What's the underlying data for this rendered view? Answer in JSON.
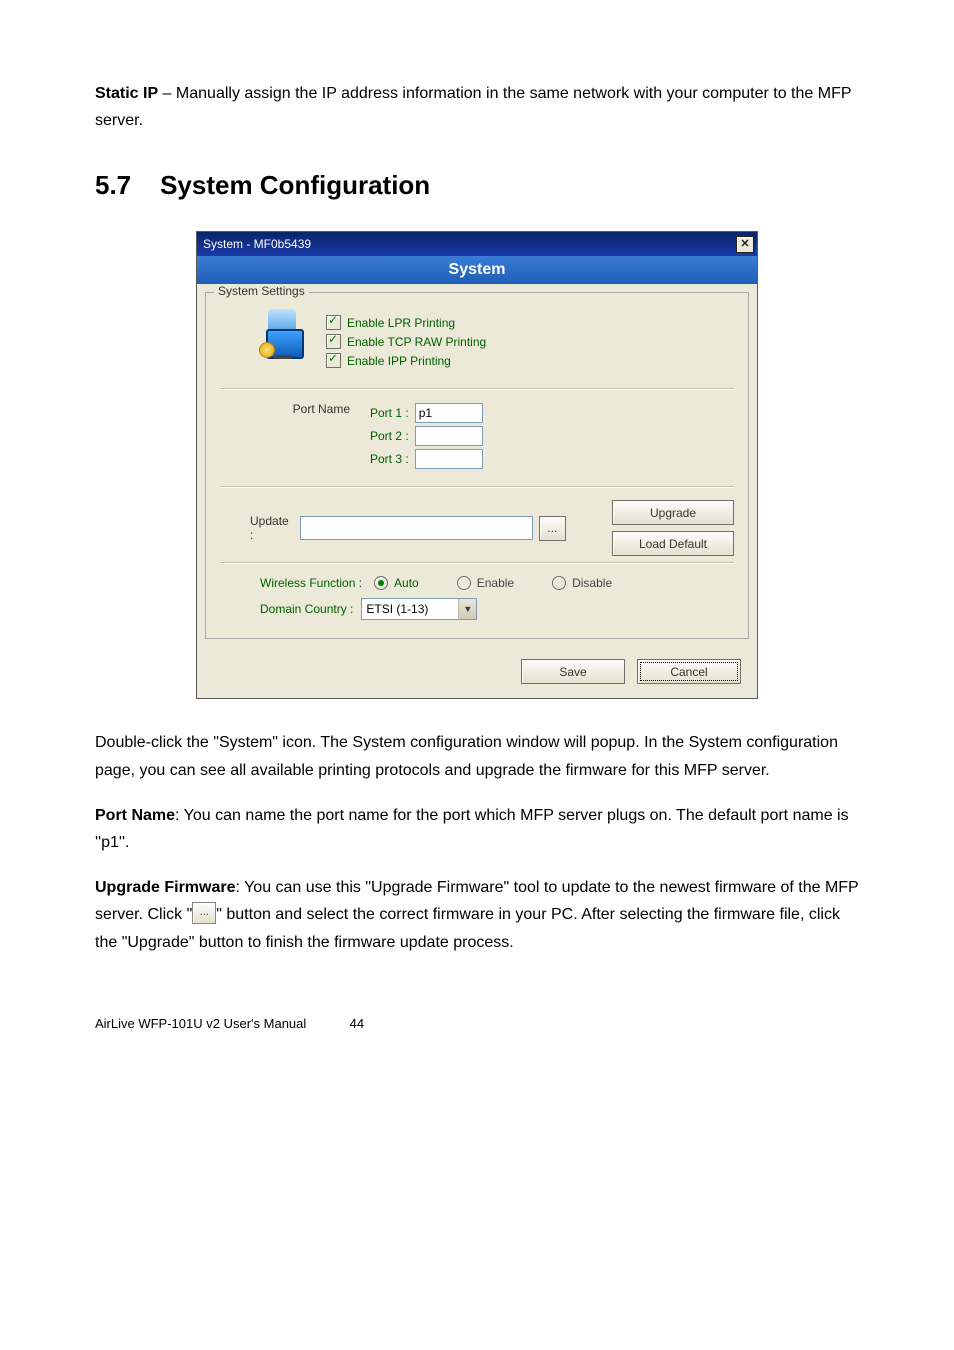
{
  "intro": {
    "static_ip_label": "Static IP",
    "static_ip_text": " – Manually assign the IP address information in the same network with your computer to the MFP server."
  },
  "heading": {
    "number": "5.7",
    "title": "System Configuration"
  },
  "dialog": {
    "titlebar": "System - MF0b5439",
    "close_x": "✕",
    "banner": "System",
    "group_legend": "System Settings",
    "checks": {
      "lpr": "Enable LPR Printing",
      "tcp": "Enable TCP RAW Printing",
      "ipp": "Enable IPP Printing"
    },
    "port_name_label": "Port Name",
    "ports": {
      "p1_label": "Port 1 :",
      "p1_value": "p1",
      "p2_label": "Port 2 :",
      "p2_value": "",
      "p3_label": "Port 3 :",
      "p3_value": ""
    },
    "update_label": "Update :",
    "update_value": "",
    "browse_btn": "...",
    "upgrade_btn": "Upgrade",
    "load_default_btn": "Load Default",
    "wireless_label": "Wireless Function :",
    "wireless_auto": "Auto",
    "wireless_enable": "Enable",
    "wireless_disable": "Disable",
    "domain_label": "Domain Country :",
    "domain_value": "ETSI (1-13)",
    "save_btn": "Save",
    "cancel_btn": "Cancel"
  },
  "paragraphs": {
    "p1": "Double-click the \"System\" icon. The System configuration window will popup. In the System configuration page, you can see all available printing protocols and upgrade the firmware for this MFP server.",
    "portname_label": "Port Name",
    "portname_text": ": You can name the port name for the port which MFP server plugs on. The default port name is ''p1''.",
    "upgrade_label": "Upgrade Firmware",
    "upgrade_text1": ": You can use this \"Upgrade Firmware\" tool to update to the newest firmware of the MFP server. Click \"",
    "upgrade_text2": "\" button and select the correct firmware in your PC. After selecting the firmware file, click the \"Upgrade\" button to finish the firmware update process."
  },
  "footer": {
    "left": "AirLive WFP-101U v2 User's Manual",
    "page": "44"
  }
}
